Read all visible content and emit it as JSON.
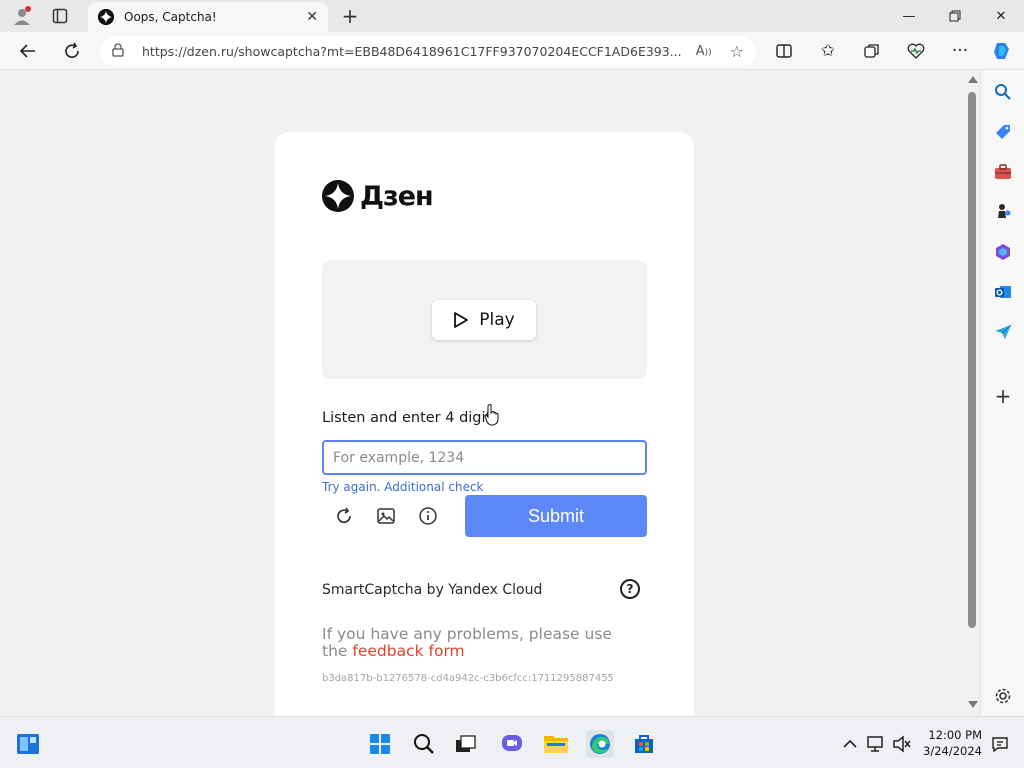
{
  "browser": {
    "tab_title": "Oops, Captcha!",
    "url": "https://dzen.ru/showcaptcha?mt=EBB48D6418961C17FF937070204ECCF1AD6E393...",
    "icons": [
      "profile-icon",
      "tab-actions-icon",
      "back-icon",
      "refresh-icon",
      "lock-icon",
      "read-aloud-icon",
      "favorite-star-icon",
      "split-screen-icon",
      "favorites-icon",
      "collections-icon",
      "browser-essentials-icon",
      "more-icon",
      "copilot-icon"
    ]
  },
  "page": {
    "logo_text": "Дзен",
    "play_label": "Play",
    "instruction": "Listen and enter 4 digits",
    "input": {
      "value": "",
      "placeholder": "For example, 1234"
    },
    "try_again": "Try again. Additional check",
    "submit_label": "Submit",
    "brand_text": "SmartCaptcha by Yandex Cloud",
    "help_glyph": "?",
    "problems_text": "If you have any problems, please use the",
    "feedback_link": "feedback form",
    "token": "b3da817b-b1276578-cd4a942c-c3b6cfcc:1711295887455"
  },
  "sidebar": {
    "icons": [
      "search-icon",
      "tag-icon",
      "toolbox-icon",
      "chess-icon",
      "office-icon",
      "outlook-icon",
      "send-icon",
      "add-icon",
      "settings-icon"
    ]
  },
  "taskbar": {
    "time": "12:00 PM",
    "date": "3/24/2024",
    "icons": [
      "widgets-icon",
      "start-icon",
      "search-icon",
      "task-view-icon",
      "chat-icon",
      "file-explorer-icon",
      "edge-icon",
      "store-icon",
      "chevron-up-icon",
      "network-icon",
      "volume-icon",
      "notification-icon"
    ]
  },
  "colors": {
    "accent": "#5c87f7",
    "link": "#3e6ecf",
    "feedback": "#e0432a"
  }
}
